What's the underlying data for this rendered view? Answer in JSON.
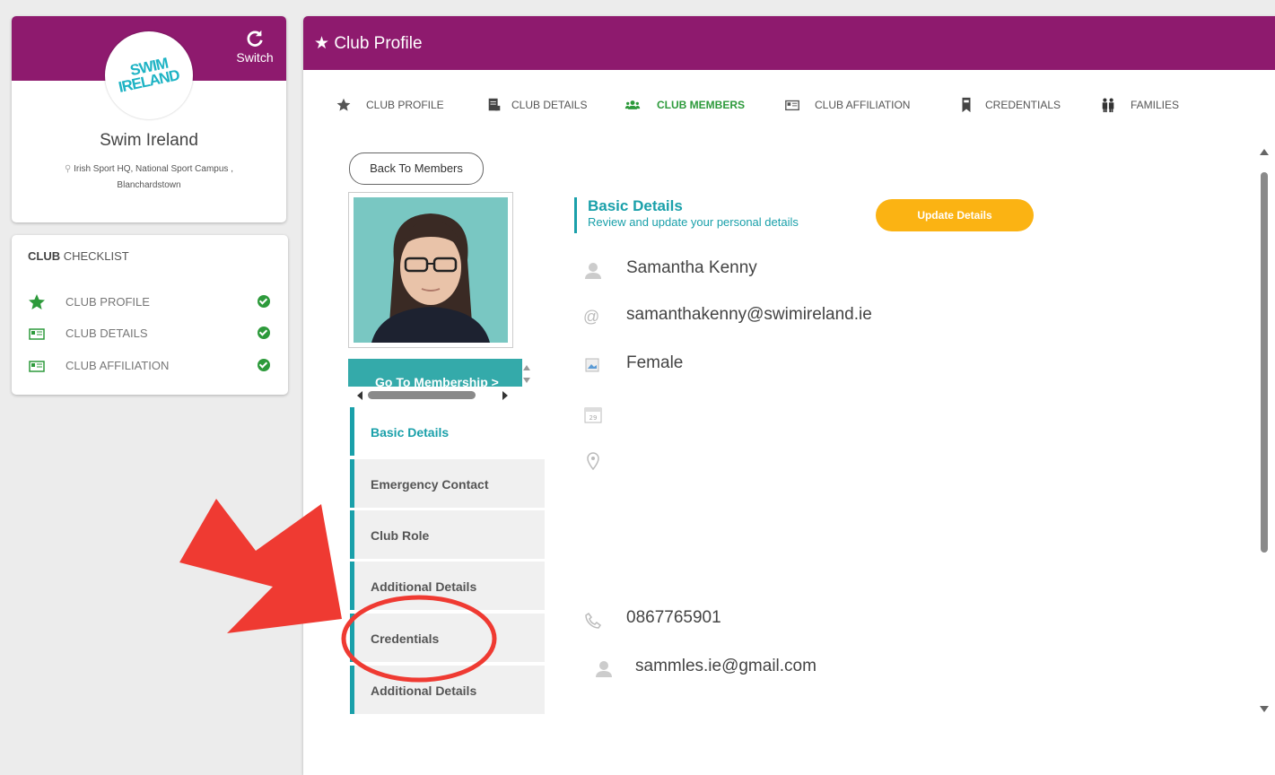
{
  "club": {
    "logo_text_1": "SWIM",
    "logo_text_2": "IRELAND",
    "switch_label": "Switch",
    "name": "Swim Ireland",
    "address_line1": "Irish Sport HQ, National Sport Campus ,",
    "address_line2": "Blanchardstown"
  },
  "checklist": {
    "title_bold": "CLUB",
    "title_rest": " CHECKLIST",
    "items": [
      {
        "label": "CLUB PROFILE",
        "icon": "star-icon",
        "done": true
      },
      {
        "label": "CLUB DETAILS",
        "icon": "id-card-icon",
        "done": true
      },
      {
        "label": "CLUB AFFILIATION",
        "icon": "id-card-icon",
        "done": true
      }
    ]
  },
  "main": {
    "title": "Club Profile",
    "tabs": [
      {
        "label": "CLUB PROFILE",
        "icon": "star-icon"
      },
      {
        "label": "CLUB DETAILS",
        "icon": "document-icon"
      },
      {
        "label": "CLUB MEMBERS",
        "icon": "users-icon",
        "active": true
      },
      {
        "label": "CLUB AFFILIATION",
        "icon": "id-card-icon"
      },
      {
        "label": "CREDENTIALS",
        "icon": "bookmark-icon"
      },
      {
        "label": "FAMILIES",
        "icon": "family-icon"
      }
    ],
    "back_label": "Back To Members",
    "goto_label": "Go To Membership >",
    "side_nav": [
      {
        "label": "Basic Details",
        "active": true
      },
      {
        "label": "Emergency Contact"
      },
      {
        "label": "Club Role"
      },
      {
        "label": "Additional Details"
      },
      {
        "label": "Credentials"
      },
      {
        "label": "Additional Details"
      }
    ],
    "section": {
      "title": "Basic Details",
      "subtitle": "Review and update your personal details",
      "update_label": "Update Details"
    },
    "details": {
      "name": "Samantha Kenny",
      "email": "samanthakenny@swimireland.ie",
      "gender": "Female",
      "phone": "0867765901",
      "contact_email": "sammles.ie@gmail.com"
    }
  },
  "colors": {
    "header": "#8e1a6e",
    "teal": "#1aa0aa",
    "green": "#2d9a3b",
    "orange": "#fbb313",
    "annotation_red": "#ef3a32"
  }
}
